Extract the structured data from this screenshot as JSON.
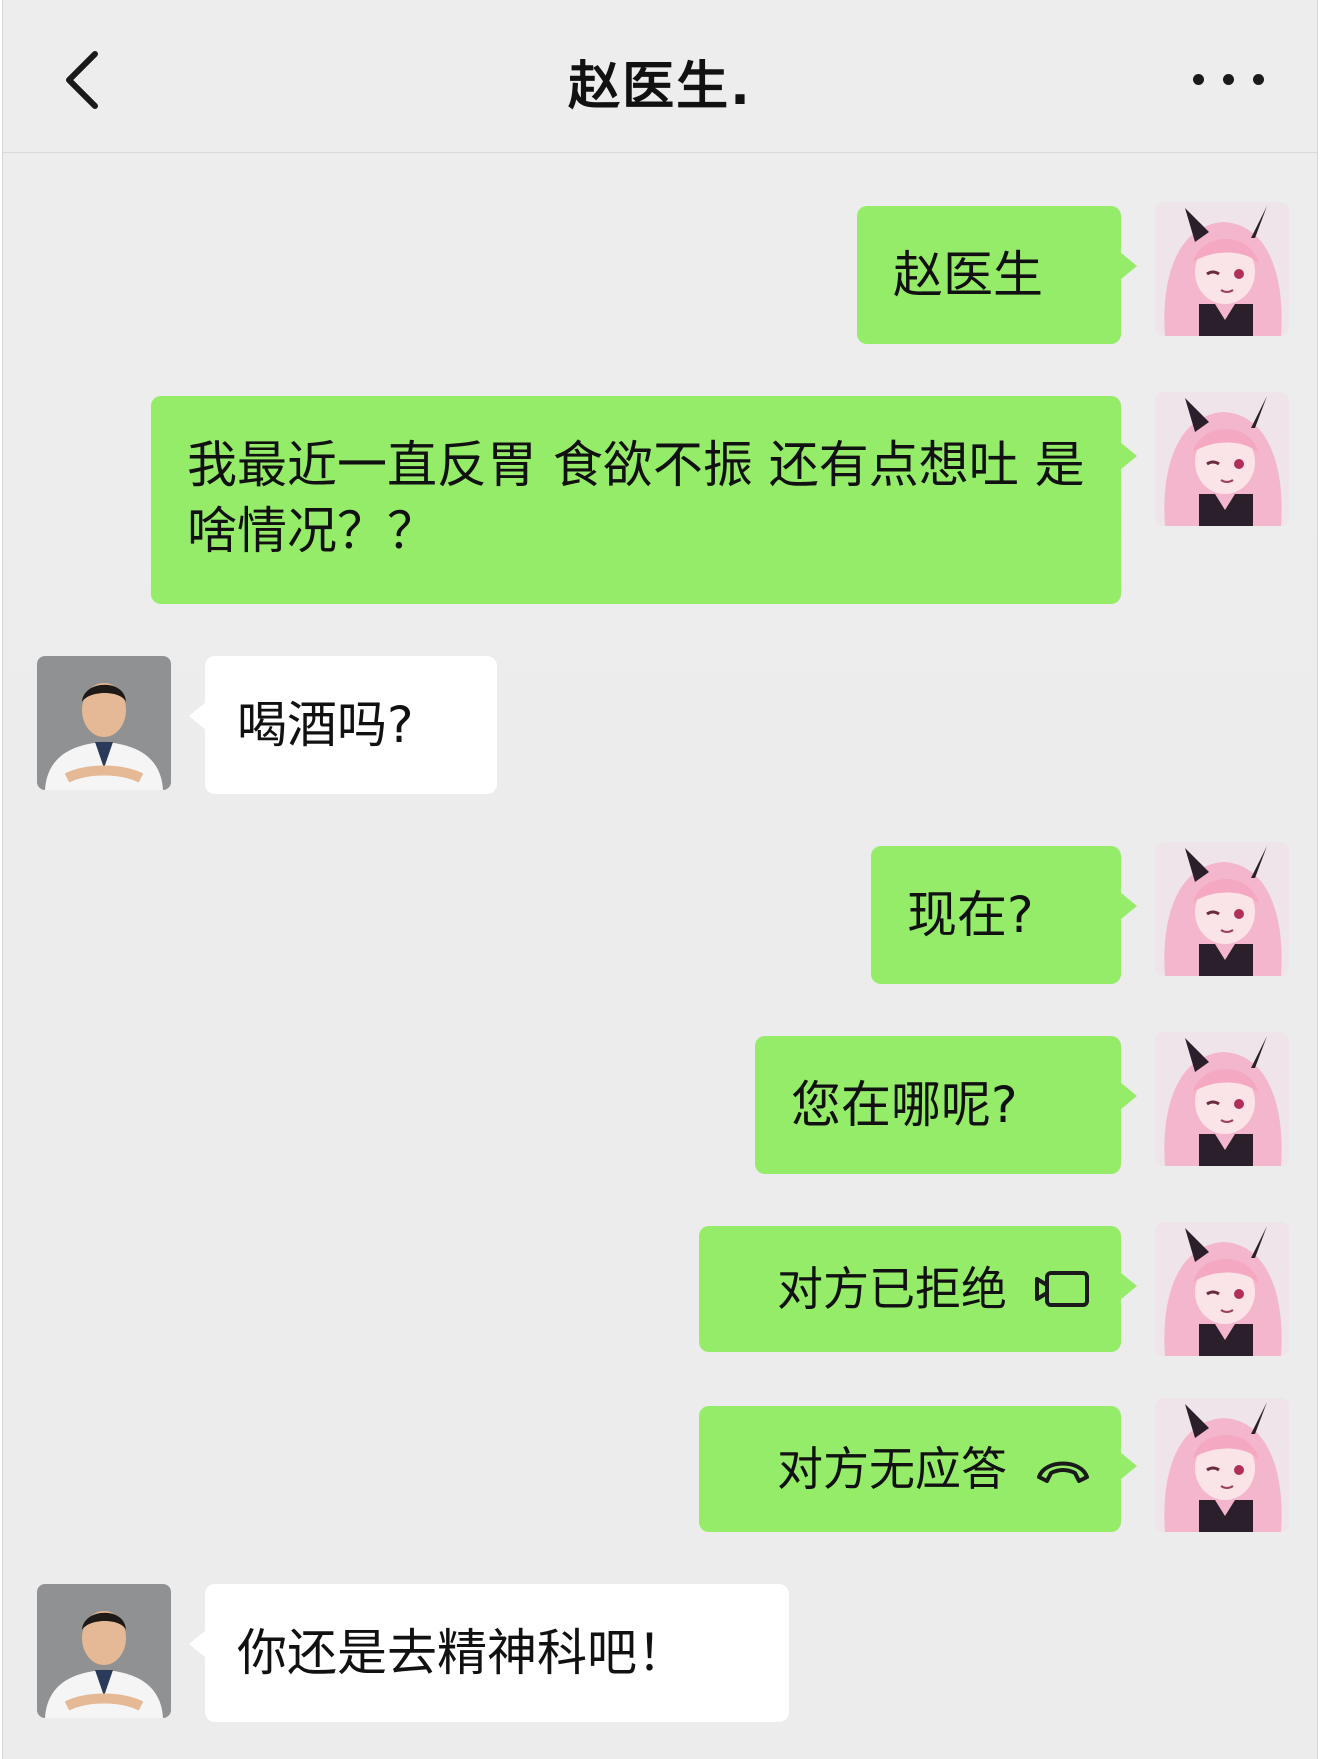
{
  "header": {
    "title": "赵医生."
  },
  "messages": [
    {
      "from": "me",
      "text": "赵医生"
    },
    {
      "from": "me",
      "text": "我最近一直反胃 食欲不振 还有点想吐 是啥情况？？"
    },
    {
      "from": "doctor",
      "text": "喝酒吗?"
    },
    {
      "from": "me",
      "text": "现在?"
    },
    {
      "from": "me",
      "text": "您在哪呢?"
    },
    {
      "from": "me",
      "text": "对方已拒绝",
      "icon": "video-call-icon"
    },
    {
      "from": "me",
      "text": "对方无应答",
      "icon": "phone-hangup-icon"
    },
    {
      "from": "doctor",
      "text": "你还是去精神科吧！"
    }
  ],
  "colors": {
    "outgoing_bubble": "#95ec69",
    "incoming_bubble": "#ffffff",
    "background": "#ededed"
  }
}
